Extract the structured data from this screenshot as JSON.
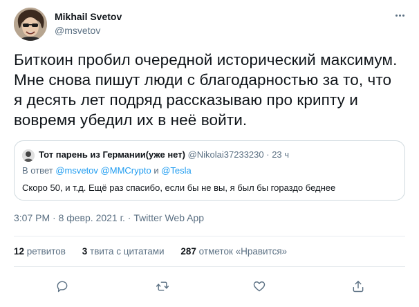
{
  "tweet": {
    "author": {
      "name": "Mikhail Svetov",
      "handle": "@msvetov"
    },
    "text_lines": [
      "Биткоин пробил очередной исторический максимум.",
      "Мне снова пишут люди с благодарностью за то, что",
      "я десять лет подряд рассказываю про крипту и",
      "вовремя убедил их в неё войти."
    ],
    "quote": {
      "name": "Тот парень из Германии(уже нет)",
      "handle": "@Nikolai37233230",
      "separator": " · ",
      "time": "23 ч",
      "reply_prefix": "В ответ ",
      "reply_user1": "@msvetov",
      "reply_user2": "@MMCrypto",
      "reply_and": " и ",
      "reply_user3": "@Tesla",
      "text": "Скоро 50, и т.д. Ещё раз спасибо, если бы не вы, я был бы гораздо беднее"
    },
    "timestamp": "3:07 PM · 8 февр. 2021 г. · Twitter Web App",
    "stats": {
      "retweets_count": "12",
      "retweets_label": "ретвитов",
      "quotes_count": "3",
      "quotes_label": "твита с цитатами",
      "likes_count": "287",
      "likes_label": "отметок «Нравится»"
    }
  },
  "icons": {
    "more": "more-horizontal-icon",
    "reply": "reply-bubble-icon",
    "retweet": "retweet-icon",
    "like": "heart-icon",
    "share": "share-icon"
  },
  "colors": {
    "text": "#0f1419",
    "secondary": "#5b7083",
    "link": "#1d9bf0",
    "border": "#cfd9de"
  }
}
